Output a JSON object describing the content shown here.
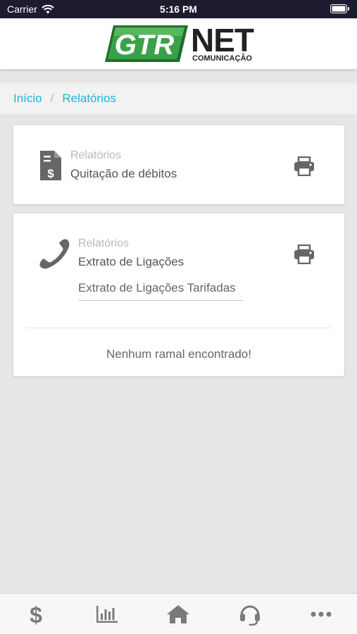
{
  "status_bar": {
    "carrier": "Carrier",
    "time": "5:16 PM"
  },
  "header": {
    "logo_text_main": "GTR",
    "logo_text_net": "NET",
    "logo_text_sub": "COMUNICAÇÃO",
    "colors": {
      "logo_green": "#2e8b3a",
      "logo_dark": "#222222"
    }
  },
  "breadcrumb": {
    "items": [
      {
        "label": "Início"
      },
      {
        "label": "Relatórios"
      }
    ],
    "separator": "/"
  },
  "cards": [
    {
      "icon": "receipt-dollar-icon",
      "label": "Relatórios",
      "title": "Quitação de débitos",
      "action_icon": "printer-icon"
    },
    {
      "icon": "phone-icon",
      "label": "Relatórios",
      "title": "Extrato de Ligações",
      "action_icon": "printer-icon",
      "select_value": "Extrato de Ligações Tarifadas",
      "empty_message": "Nenhum ramal encontrado!"
    }
  ],
  "tabbar": {
    "items": [
      {
        "icon": "dollar-icon"
      },
      {
        "icon": "bar-chart-icon"
      },
      {
        "icon": "home-icon"
      },
      {
        "icon": "headset-icon"
      },
      {
        "icon": "more-icon"
      }
    ]
  },
  "colors": {
    "accent": "#25b3d5",
    "background": "#e6e6e6",
    "icon_gray": "#666666"
  }
}
